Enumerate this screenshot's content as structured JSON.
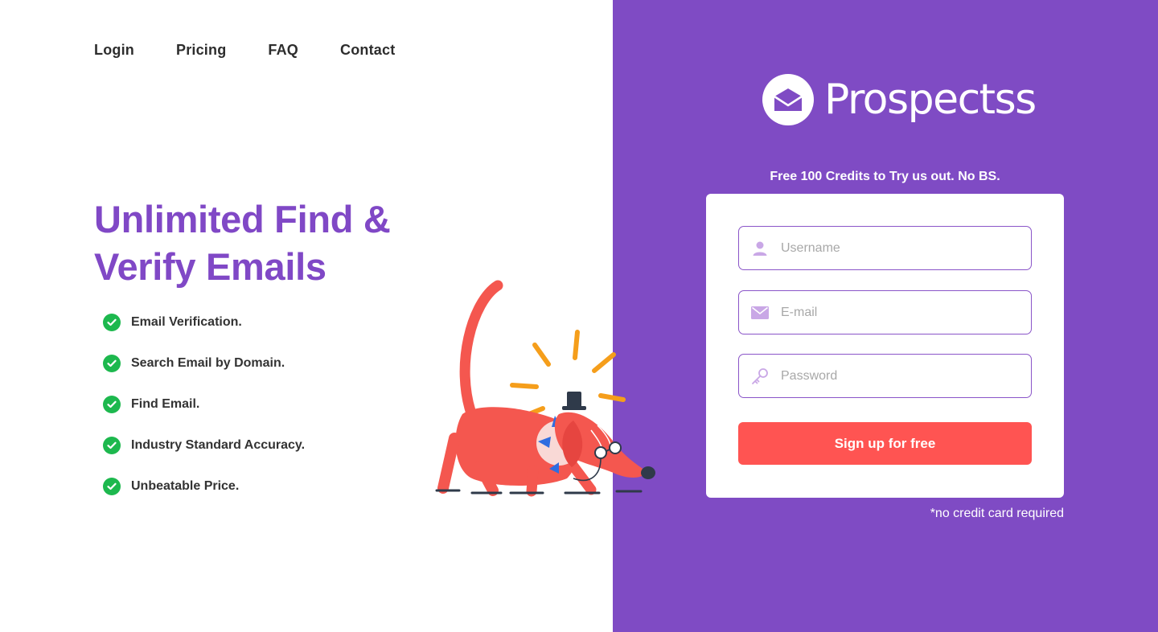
{
  "nav": {
    "items": [
      {
        "label": "Login"
      },
      {
        "label": "Pricing"
      },
      {
        "label": "FAQ"
      },
      {
        "label": "Contact"
      }
    ]
  },
  "hero": {
    "title_line1": "Unlimited Find &",
    "title_line2": "Verify Emails"
  },
  "features": [
    {
      "text": "Email Verification."
    },
    {
      "text": "Search Email by Domain."
    },
    {
      "text": "Find Email."
    },
    {
      "text": "Industry Standard Accuracy."
    },
    {
      "text": "Unbeatable Price."
    }
  ],
  "brand": {
    "name": "Prospectss",
    "icon": "envelope-icon"
  },
  "signup": {
    "promo": "Free 100 Credits to Try us out. No BS.",
    "username_placeholder": "Username",
    "email_placeholder": "E-mail",
    "password_placeholder": "Password",
    "button_label": "Sign up for free",
    "note": "*no credit card required"
  },
  "colors": {
    "brand_purple": "#7f4bc4",
    "hero_purple": "#8048c6",
    "cta_red": "#ff5452",
    "check_green": "#1db84e",
    "dog_red": "#f4574f",
    "accent_orange": "#f59e1b"
  }
}
